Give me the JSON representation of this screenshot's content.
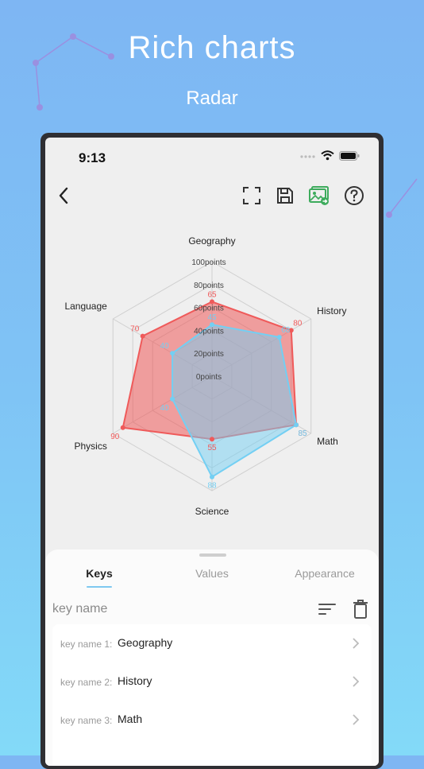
{
  "headline": "Rich charts",
  "subheadline": "Radar",
  "status_bar": {
    "time": "9:13"
  },
  "toolbar": {
    "back": "back-arrow-icon",
    "fullscreen": "fullscreen-icon",
    "save": "save-icon",
    "export_image": "image-export-icon",
    "help": "help-icon"
  },
  "chart_data": {
    "type": "radar",
    "axes": [
      "Geography",
      "History",
      "Math",
      "Science",
      "Physics",
      "Language"
    ],
    "scale_labels": [
      "0points",
      "20points",
      "40points",
      "60points",
      "80points",
      "100points"
    ],
    "range": [
      0,
      100
    ],
    "series": [
      {
        "values": [
          65,
          80,
          85,
          55,
          90,
          70
        ],
        "color": "#ef5a5a"
      },
      {
        "values": [
          45,
          68,
          85,
          88,
          40,
          40
        ],
        "color": "#73cff3"
      }
    ]
  },
  "sheet": {
    "tabs": [
      {
        "label": "Keys",
        "active": true
      },
      {
        "label": "Values",
        "active": false
      },
      {
        "label": "Appearance",
        "active": false
      }
    ],
    "key_header": "key name",
    "sort_icon": "sort-icon",
    "delete_icon": "trash-icon",
    "rows": [
      {
        "label": "key name 1:",
        "value": "Geography"
      },
      {
        "label": "key name 2:",
        "value": "History"
      },
      {
        "label": "key name 3:",
        "value": "Math"
      }
    ]
  }
}
